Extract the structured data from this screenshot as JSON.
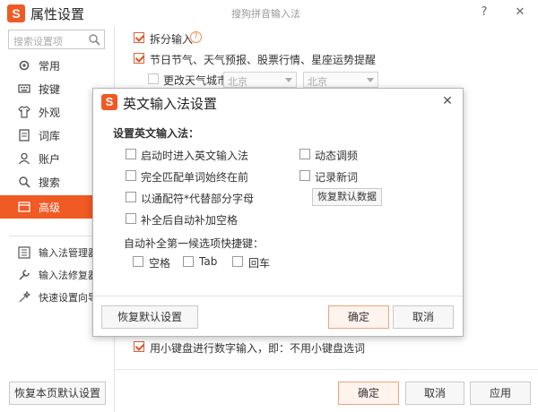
{
  "window": {
    "title": "属性设置",
    "center_title": "搜狗拼音输入法",
    "help_label": "?",
    "close_label": "✕"
  },
  "sidebar": {
    "search_placeholder": "搜索设置项",
    "items": [
      {
        "label": "常用",
        "icon": "gear-icon"
      },
      {
        "label": "按键",
        "icon": "keyboard-icon"
      },
      {
        "label": "外观",
        "icon": "shirt-icon"
      },
      {
        "label": "词库",
        "icon": "book-icon"
      },
      {
        "label": "账户",
        "icon": "user-icon"
      },
      {
        "label": "搜索",
        "icon": "search-icon"
      },
      {
        "label": "高级",
        "icon": "advanced-icon",
        "active": true
      }
    ],
    "tools": [
      {
        "label": "输入法管理器",
        "icon": "manager-icon"
      },
      {
        "label": "输入法修复器",
        "icon": "repair-icon"
      },
      {
        "label": "快速设置向导",
        "icon": "wizard-icon"
      }
    ]
  },
  "content": {
    "split_input": {
      "label": "拆分输入",
      "checked": true
    },
    "festival": {
      "label": "节日节气、天气预报、股票行情、星座运势提醒",
      "checked": true
    },
    "change_city": {
      "label": "更改天气城市",
      "checked": false
    },
    "province_select": "北京",
    "city_select": "北京",
    "numeric_keypad": {
      "label": "用小键盘进行数字输入，即：不用小键盘选词",
      "checked": true
    }
  },
  "footer": {
    "restore_page": "恢复本页默认设置",
    "ok": "确定",
    "cancel": "取消",
    "apply": "应用"
  },
  "dialog": {
    "title": "英文输入法设置",
    "section_title": "设置英文输入法：",
    "options_left": [
      {
        "label": "启动时进入英文输入法",
        "checked": false
      },
      {
        "label": "完全匹配单词始终在前",
        "checked": false
      },
      {
        "label": "以通配符*代替部分字母",
        "checked": false
      },
      {
        "label": "补全后自动补加空格",
        "checked": false
      }
    ],
    "options_right": [
      {
        "label": "动态调频",
        "checked": false
      },
      {
        "label": "记录新词",
        "checked": false
      }
    ],
    "restore_data": "恢复默认数据",
    "shortcut_title": "自动补全第一候选项快捷键：",
    "shortcuts": [
      {
        "label": "空格",
        "checked": false
      },
      {
        "label": "Tab",
        "checked": false
      },
      {
        "label": "回车",
        "checked": false
      }
    ],
    "restore_defaults": "恢复默认设置",
    "ok": "确定",
    "cancel": "取消"
  },
  "colors": {
    "accent": "#f05a24"
  }
}
